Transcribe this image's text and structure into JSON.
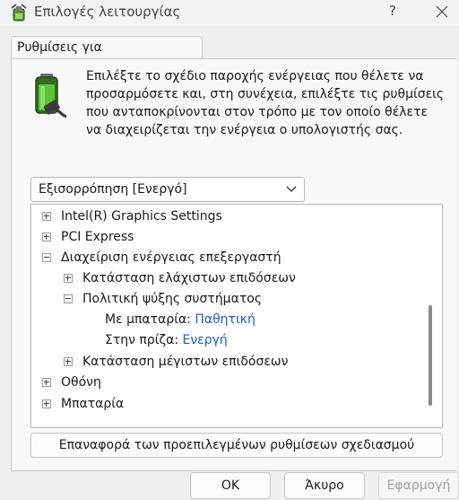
{
  "window": {
    "title": "Επιλογές λειτουργίας",
    "help_label": "?"
  },
  "tab": {
    "label": "Ρυθμίσεις για προχωρημένους"
  },
  "description": "Επιλέξτε το σχέδιο παροχής ενέργειας που θέλετε να προσαρμόσετε και, στη συνέχεια, επιλέξτε τις ρυθμίσεις που ανταποκρίνονται στον τρόπο με τον οποίο θέλετε να διαχειρίζεται την ενέργεια ο υπολογιστής σας.",
  "plan_select": {
    "value": "Εξισορρόπηση [Ενεργό]"
  },
  "tree": {
    "items": [
      {
        "label": "Intel(R) Graphics Settings",
        "expander": "plus"
      },
      {
        "label": "PCI Express",
        "expander": "plus"
      },
      {
        "label": "Διαχείριση ενέργειας επεξεργαστή",
        "expander": "minus"
      },
      {
        "label": "Κατάσταση ελάχιστων επιδόσεων",
        "expander": "plus"
      },
      {
        "label": "Πολιτική ψύξης συστήματος",
        "expander": "minus"
      },
      {
        "label": "Με μπαταρία:",
        "value": "Παθητική"
      },
      {
        "label": "Στην πρίζα:",
        "value": "Ενεργή"
      },
      {
        "label": "Κατάσταση μέγιστων επιδόσεων",
        "expander": "plus"
      },
      {
        "label": "Οθόνη",
        "expander": "plus"
      },
      {
        "label": "Μπαταρία",
        "expander": "plus"
      }
    ]
  },
  "buttons": {
    "restore": "Επαναφορά των προεπιλεγμένων ρυθμίσεων σχεδιασμού",
    "ok": "OK",
    "cancel": "Άκυρο",
    "apply": "Εφαρμογή"
  },
  "colors": {
    "value_link": "#1f5fbf",
    "battery_green": "#3fae2a"
  }
}
